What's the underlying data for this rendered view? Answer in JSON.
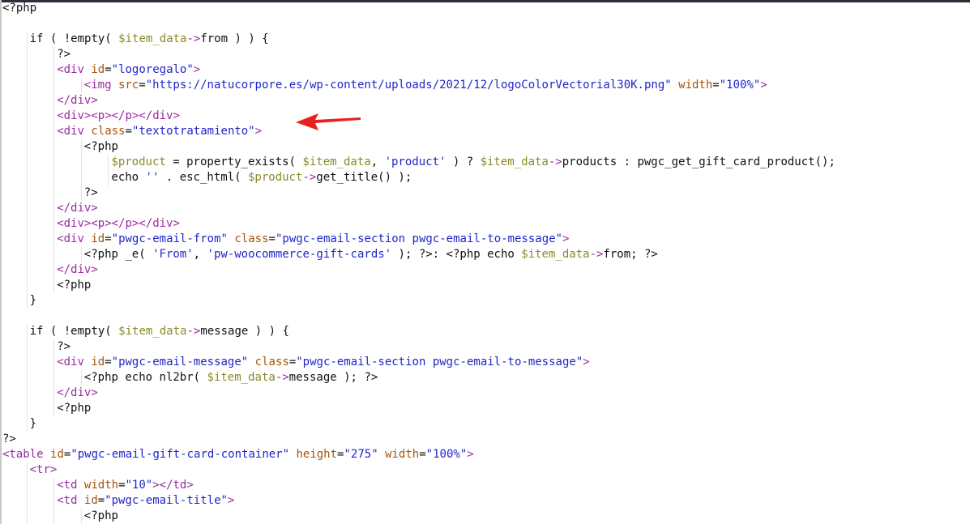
{
  "colors": {
    "plain": "#111111",
    "tag": "#9b2aa3",
    "attr": "#a8540a",
    "string": "#1f26c9",
    "variable": "#8a8a2a",
    "arrow": "#e8211f"
  },
  "arrow": {
    "icon": "red-arrow-annotation-icon"
  },
  "lines": [
    {
      "indent": 0,
      "tokens": [
        [
          "<?php",
          "p"
        ]
      ]
    },
    {
      "indent": 0,
      "tokens": []
    },
    {
      "indent": 1,
      "tokens": [
        [
          "if ( !empty( ",
          "p"
        ],
        [
          "$item_data",
          "v"
        ],
        [
          "->",
          "t"
        ],
        [
          "from ) ) {",
          "p"
        ]
      ]
    },
    {
      "indent": 2,
      "tokens": [
        [
          "?>",
          "p"
        ]
      ]
    },
    {
      "indent": 2,
      "tokens": [
        [
          "<div ",
          "t"
        ],
        [
          "id",
          "a"
        ],
        [
          "=",
          "p"
        ],
        [
          "\"logoregalo\"",
          "s"
        ],
        [
          ">",
          "t"
        ]
      ]
    },
    {
      "indent": 3,
      "tokens": [
        [
          "<img ",
          "t"
        ],
        [
          "src",
          "a"
        ],
        [
          "=",
          "p"
        ],
        [
          "\"https://natucorpore.es/wp-content/uploads/2021/12/logoColorVectorial30K.png\"",
          "s"
        ],
        [
          " ",
          "p"
        ],
        [
          "width",
          "a"
        ],
        [
          "=",
          "p"
        ],
        [
          "\"100%\"",
          "s"
        ],
        [
          ">",
          "t"
        ]
      ]
    },
    {
      "indent": 2,
      "tokens": [
        [
          "</div>",
          "t"
        ]
      ]
    },
    {
      "indent": 2,
      "tokens": [
        [
          "<div><p></p></div>",
          "t"
        ]
      ]
    },
    {
      "indent": 2,
      "tokens": [
        [
          "<div ",
          "t"
        ],
        [
          "class",
          "a"
        ],
        [
          "=",
          "p"
        ],
        [
          "\"textotratamiento\"",
          "s"
        ],
        [
          ">",
          "t"
        ]
      ]
    },
    {
      "indent": 3,
      "tokens": [
        [
          "<?php",
          "p"
        ]
      ]
    },
    {
      "indent": 4,
      "tokens": [
        [
          "$product",
          "v"
        ],
        [
          " = property_exists( ",
          "p"
        ],
        [
          "$item_data",
          "v"
        ],
        [
          ", ",
          "p"
        ],
        [
          "'product'",
          "s"
        ],
        [
          " ) ? ",
          "p"
        ],
        [
          "$item_data",
          "v"
        ],
        [
          "->",
          "t"
        ],
        [
          "products : pwgc_get_gift_card_product();",
          "p"
        ]
      ]
    },
    {
      "indent": 4,
      "tokens": [
        [
          "echo ",
          "p"
        ],
        [
          "''",
          "s"
        ],
        [
          " . esc_html( ",
          "p"
        ],
        [
          "$product",
          "v"
        ],
        [
          "->",
          "t"
        ],
        [
          "get_title() );",
          "p"
        ]
      ]
    },
    {
      "indent": 3,
      "tokens": [
        [
          "?>",
          "p"
        ]
      ]
    },
    {
      "indent": 2,
      "tokens": [
        [
          "</div>",
          "t"
        ]
      ]
    },
    {
      "indent": 2,
      "tokens": [
        [
          "<div><p></p></div>",
          "t"
        ]
      ]
    },
    {
      "indent": 2,
      "tokens": [
        [
          "<div ",
          "t"
        ],
        [
          "id",
          "a"
        ],
        [
          "=",
          "p"
        ],
        [
          "\"pwgc-email-from\"",
          "s"
        ],
        [
          " ",
          "p"
        ],
        [
          "class",
          "a"
        ],
        [
          "=",
          "p"
        ],
        [
          "\"pwgc-email-section pwgc-email-to-message\"",
          "s"
        ],
        [
          ">",
          "t"
        ]
      ]
    },
    {
      "indent": 3,
      "tokens": [
        [
          "<?php _e( ",
          "p"
        ],
        [
          "'From'",
          "s"
        ],
        [
          ", ",
          "p"
        ],
        [
          "'pw-woocommerce-gift-cards'",
          "s"
        ],
        [
          " ); ?>: <?php echo ",
          "p"
        ],
        [
          "$item_data",
          "v"
        ],
        [
          "->",
          "t"
        ],
        [
          "from; ?>",
          "p"
        ]
      ]
    },
    {
      "indent": 2,
      "tokens": [
        [
          "</div>",
          "t"
        ]
      ]
    },
    {
      "indent": 2,
      "tokens": [
        [
          "<?php",
          "p"
        ]
      ]
    },
    {
      "indent": 1,
      "tokens": [
        [
          "}",
          "p"
        ]
      ]
    },
    {
      "indent": 0,
      "tokens": []
    },
    {
      "indent": 1,
      "tokens": [
        [
          "if ( !empty( ",
          "p"
        ],
        [
          "$item_data",
          "v"
        ],
        [
          "->",
          "t"
        ],
        [
          "message ) ) {",
          "p"
        ]
      ]
    },
    {
      "indent": 2,
      "tokens": [
        [
          "?>",
          "p"
        ]
      ]
    },
    {
      "indent": 2,
      "tokens": [
        [
          "<div ",
          "t"
        ],
        [
          "id",
          "a"
        ],
        [
          "=",
          "p"
        ],
        [
          "\"pwgc-email-message\"",
          "s"
        ],
        [
          " ",
          "p"
        ],
        [
          "class",
          "a"
        ],
        [
          "=",
          "p"
        ],
        [
          "\"pwgc-email-section pwgc-email-to-message\"",
          "s"
        ],
        [
          ">",
          "t"
        ]
      ]
    },
    {
      "indent": 3,
      "tokens": [
        [
          "<?php echo nl2br( ",
          "p"
        ],
        [
          "$item_data",
          "v"
        ],
        [
          "->",
          "t"
        ],
        [
          "message ); ?>",
          "p"
        ]
      ]
    },
    {
      "indent": 2,
      "tokens": [
        [
          "</div>",
          "t"
        ]
      ]
    },
    {
      "indent": 2,
      "tokens": [
        [
          "<?php",
          "p"
        ]
      ]
    },
    {
      "indent": 1,
      "tokens": [
        [
          "}",
          "p"
        ]
      ]
    },
    {
      "indent": 0,
      "tokens": [
        [
          "?>",
          "p"
        ]
      ]
    },
    {
      "indent": 0,
      "tokens": [
        [
          "<table ",
          "t"
        ],
        [
          "id",
          "a"
        ],
        [
          "=",
          "p"
        ],
        [
          "\"pwgc-email-gift-card-container\"",
          "s"
        ],
        [
          " ",
          "p"
        ],
        [
          "height",
          "a"
        ],
        [
          "=",
          "p"
        ],
        [
          "\"275\"",
          "s"
        ],
        [
          " ",
          "p"
        ],
        [
          "width",
          "a"
        ],
        [
          "=",
          "p"
        ],
        [
          "\"100%\"",
          "s"
        ],
        [
          ">",
          "t"
        ]
      ]
    },
    {
      "indent": 1,
      "tokens": [
        [
          "<tr>",
          "t"
        ]
      ]
    },
    {
      "indent": 2,
      "tokens": [
        [
          "<td ",
          "t"
        ],
        [
          "width",
          "a"
        ],
        [
          "=",
          "p"
        ],
        [
          "\"10\"",
          "s"
        ],
        [
          "></td>",
          "t"
        ]
      ]
    },
    {
      "indent": 2,
      "tokens": [
        [
          "<td ",
          "t"
        ],
        [
          "id",
          "a"
        ],
        [
          "=",
          "p"
        ],
        [
          "\"pwgc-email-title\"",
          "s"
        ],
        [
          ">",
          "t"
        ]
      ]
    },
    {
      "indent": 3,
      "tokens": [
        [
          "<?php",
          "p"
        ]
      ]
    }
  ]
}
